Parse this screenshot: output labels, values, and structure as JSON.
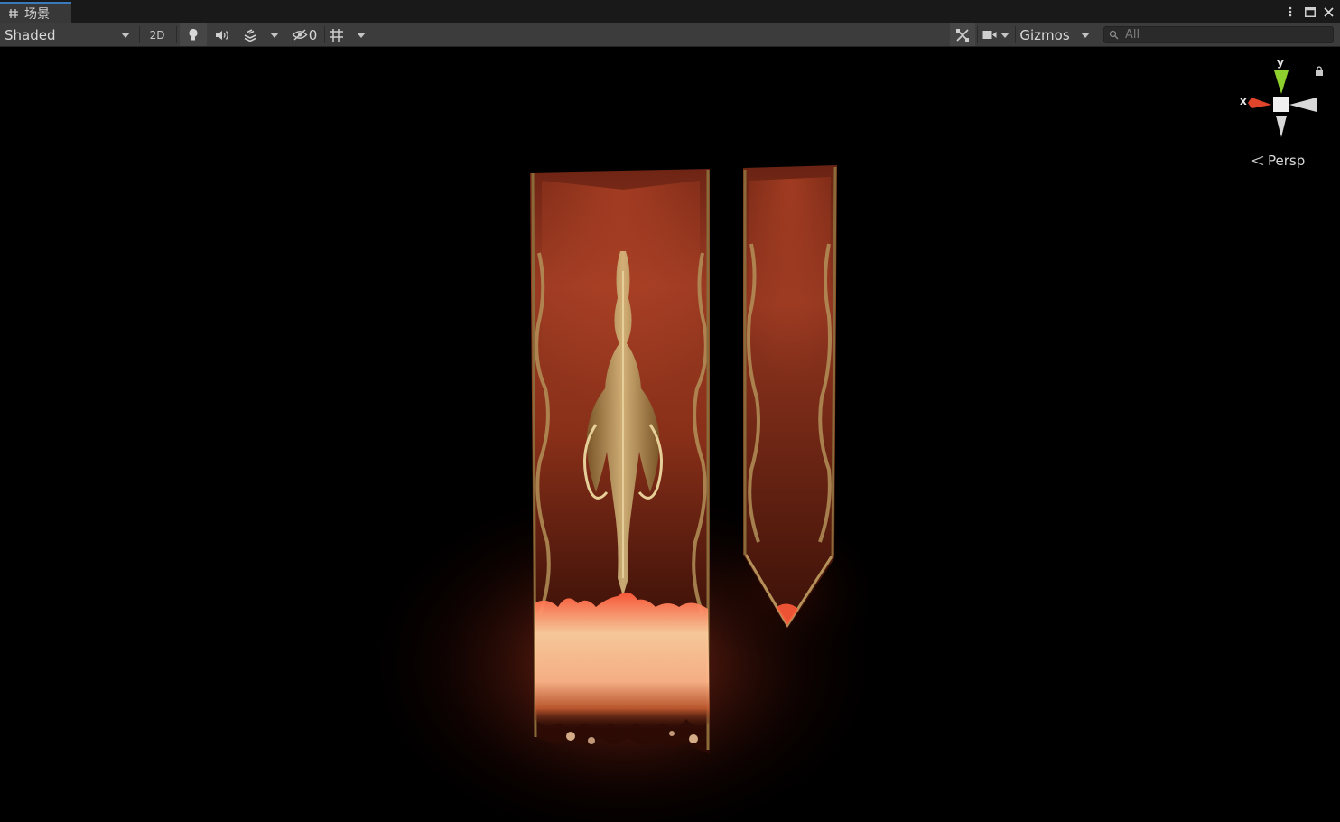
{
  "tab": {
    "icon": "scene-grid-icon",
    "label": "场景"
  },
  "window_controls": [
    {
      "name": "more-options-icon"
    },
    {
      "name": "maximize-icon"
    },
    {
      "name": "close-icon"
    }
  ],
  "toolbar": {
    "draw_mode": "Shaded",
    "mode_2d": "2D",
    "lighting_icon": "lightbulb-icon",
    "audio_icon": "speaker-icon",
    "effects_icon": "effects-layers-icon",
    "hidden_count": "0",
    "hidden_icon": "visibility-off-icon",
    "grid_icon": "grid-icon",
    "tools_icon": "tools-icon",
    "camera_icon": "camera-icon",
    "gizmos_label": "Gizmos",
    "search_placeholder": "All"
  },
  "scene_gizmo": {
    "x_label": "x",
    "y_label": "y",
    "projection": "Persp",
    "lock_icon": "lock-icon",
    "colors": {
      "x": "#e0442a",
      "y": "#8ed12f",
      "z": "#d8d8d8"
    }
  },
  "scene": {
    "objects": [
      "banner-long-flame",
      "banner-pointed"
    ],
    "colors": {
      "banner": "#8b2e1a",
      "trim": "#b9955a",
      "fire": "#ffb37a"
    }
  }
}
